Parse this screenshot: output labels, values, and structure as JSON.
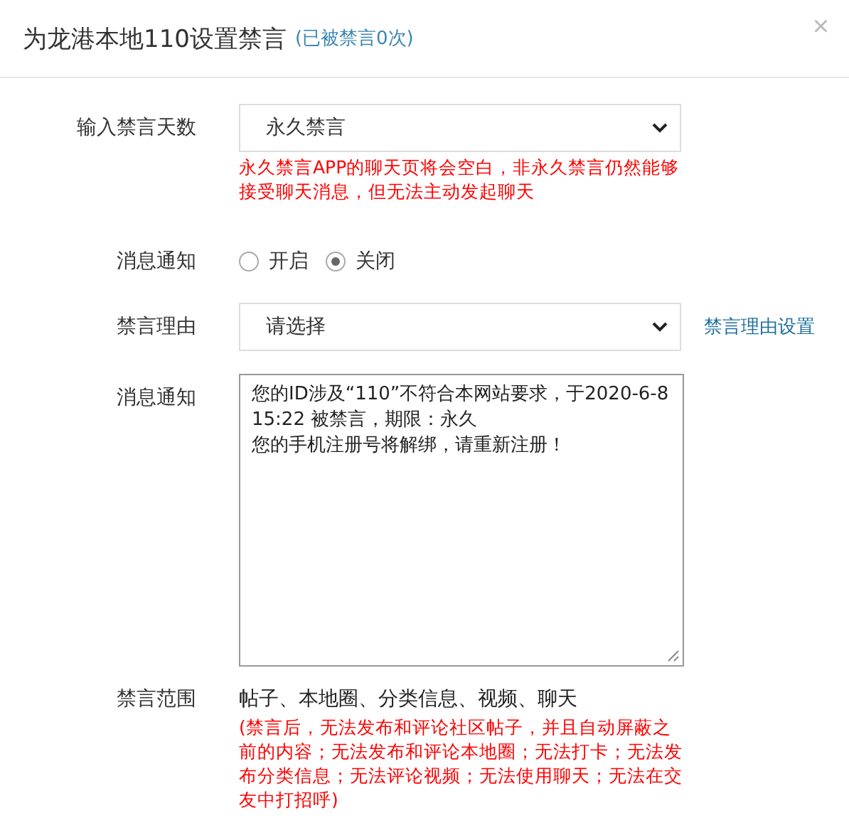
{
  "dialog": {
    "title": "为龙港本地110设置禁言",
    "count_note": "(已被禁言0次)",
    "close": "×"
  },
  "fields": [
    {
      "kind": "select",
      "label": "输入禁言天数",
      "value": "永久禁言",
      "hint": "永久禁言APP的聊天页将会空白，非永久禁言仍然能够接受聊天消息，但无法主动发起聊天"
    },
    {
      "kind": "radio",
      "label": "消息通知",
      "options": [
        {
          "label": "开启",
          "selected": false
        },
        {
          "label": "关闭",
          "selected": true
        }
      ]
    },
    {
      "kind": "select",
      "label": "禁言理由",
      "value": "请选择",
      "link": "禁言理由设置"
    },
    {
      "kind": "textarea",
      "label": "消息通知",
      "lines": [
        "您的ID涉及“110”不符合本网站要求，于2020-6-8 15:22 被禁言，期限：永久",
        "您的手机注册号将解绑，请重新注册！"
      ]
    },
    {
      "kind": "text",
      "label": "禁言范围",
      "value": "帖子、本地圈、分类信息、视频、聊天",
      "hint": "(禁言后，无法发布和评论社区帖子，并且自动屏蔽之前的内容；无法发布和评论本地圈；无法打卡；无法发布分类信息；无法评论视频；无法使用聊天；无法在交友中打招呼)"
    }
  ]
}
